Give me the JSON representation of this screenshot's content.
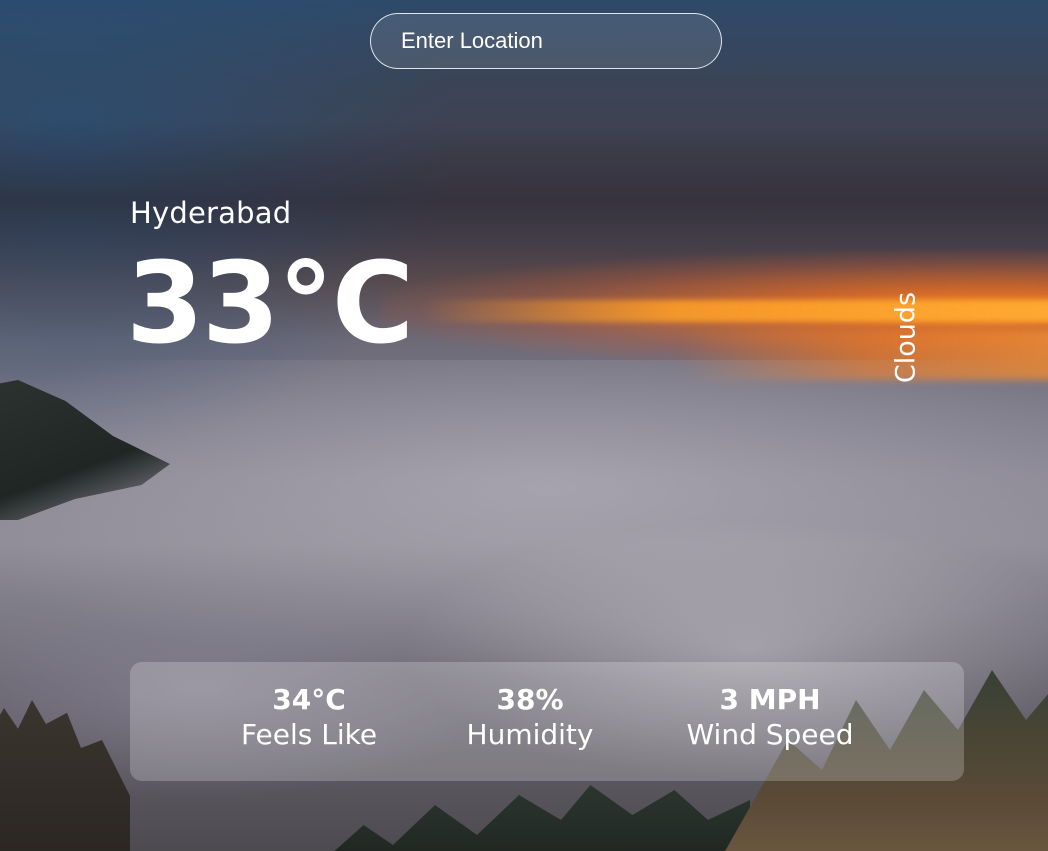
{
  "search": {
    "placeholder": "Enter Location"
  },
  "weather": {
    "location": "Hyderabad",
    "temperature": "33°C",
    "condition": "Clouds"
  },
  "stats": {
    "feels_like": {
      "value": "34°C",
      "label": "Feels Like"
    },
    "humidity": {
      "value": "38%",
      "label": "Humidity"
    },
    "wind_speed": {
      "value": "3 MPH",
      "label": "Wind Speed"
    }
  },
  "colors": {
    "text": "#ffffff",
    "panel": "rgba(255,255,255,0.22)",
    "sunset_accent": "#f08c28"
  }
}
